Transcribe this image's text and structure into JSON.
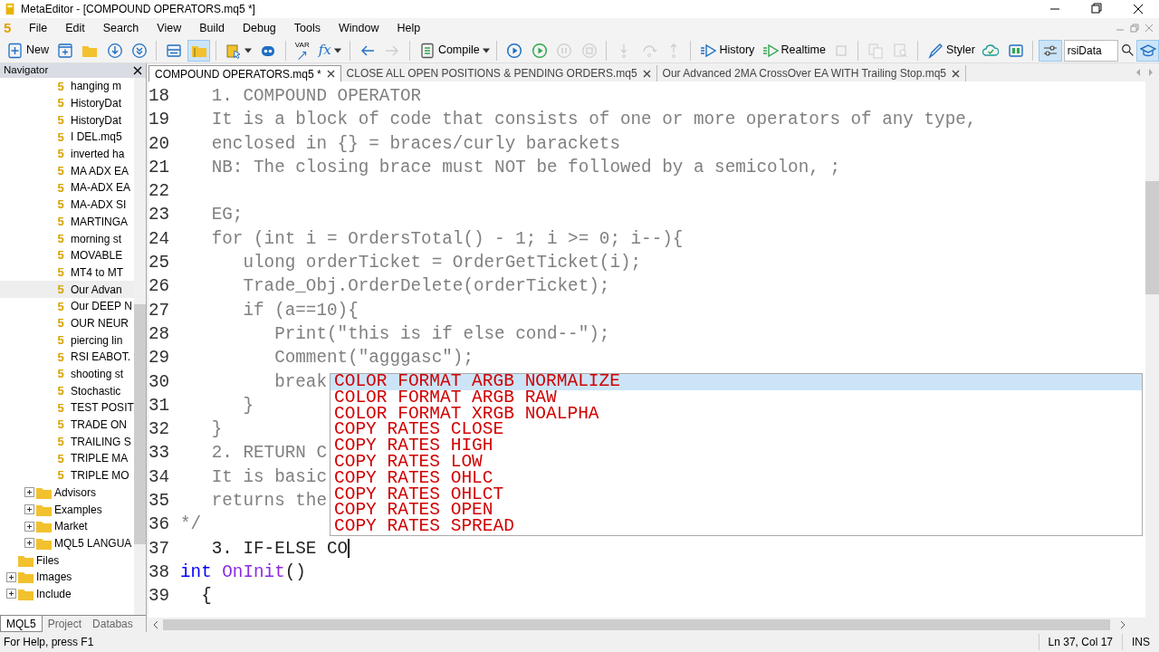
{
  "window": {
    "title": "MetaEditor - [COMPOUND OPERATORS.mq5 *]"
  },
  "menu_bar": {
    "logo": "5",
    "items": [
      "File",
      "Edit",
      "Search",
      "View",
      "Build",
      "Debug",
      "Tools",
      "Window",
      "Help"
    ]
  },
  "toolbar": [
    {
      "kind": "button",
      "label": "New",
      "pressed": false,
      "disabled": false,
      "dropdown": false
    },
    {
      "kind": "button",
      "pressed": false,
      "disabled": false,
      "dropdown": false
    },
    {
      "kind": "button",
      "pressed": false,
      "disabled": false,
      "dropdown": false
    },
    {
      "kind": "button",
      "pressed": false,
      "disabled": false,
      "dropdown": false
    },
    {
      "kind": "button",
      "pressed": false,
      "disabled": false,
      "dropdown": false
    },
    {
      "kind": "separator"
    },
    {
      "kind": "button",
      "pressed": false,
      "disabled": false,
      "dropdown": false
    },
    {
      "kind": "button",
      "pressed": true,
      "disabled": false,
      "dropdown": false
    },
    {
      "kind": "separator"
    },
    {
      "kind": "button",
      "pressed": false,
      "disabled": false,
      "dropdown": true
    },
    {
      "kind": "button",
      "pressed": false,
      "disabled": false,
      "dropdown": false
    },
    {
      "kind": "separator"
    },
    {
      "kind": "button",
      "label": "VAR",
      "pressed": false,
      "disabled": false,
      "dropdown": false
    },
    {
      "kind": "button",
      "label": "fx",
      "pressed": false,
      "disabled": false,
      "dropdown": true
    },
    {
      "kind": "separator"
    },
    {
      "kind": "button",
      "pressed": false,
      "disabled": false,
      "dropdown": false
    },
    {
      "kind": "button",
      "pressed": false,
      "disabled": true,
      "dropdown": false
    },
    {
      "kind": "separator"
    },
    {
      "kind": "button",
      "label": "Compile",
      "pressed": false,
      "disabled": false,
      "dropdown": true
    },
    {
      "kind": "separator"
    },
    {
      "kind": "button",
      "pressed": false,
      "disabled": false,
      "dropdown": false
    },
    {
      "kind": "button",
      "pressed": false,
      "disabled": false,
      "dropdown": false
    },
    {
      "kind": "button",
      "pressed": false,
      "disabled": true,
      "dropdown": false
    },
    {
      "kind": "button",
      "pressed": false,
      "disabled": true,
      "dropdown": false
    },
    {
      "kind": "separator"
    },
    {
      "kind": "button",
      "pressed": false,
      "disabled": true,
      "dropdown": false
    },
    {
      "kind": "button",
      "pressed": false,
      "disabled": true,
      "dropdown": false
    },
    {
      "kind": "button",
      "pressed": false,
      "disabled": true,
      "dropdown": false
    },
    {
      "kind": "separator"
    },
    {
      "kind": "button",
      "label": "History",
      "pressed": false,
      "disabled": false,
      "dropdown": false
    },
    {
      "kind": "button",
      "label": "Realtime",
      "pressed": false,
      "disabled": false,
      "dropdown": false
    },
    {
      "kind": "button",
      "pressed": false,
      "disabled": true,
      "dropdown": false
    },
    {
      "kind": "separator"
    },
    {
      "kind": "button",
      "pressed": false,
      "disabled": true,
      "dropdown": false
    },
    {
      "kind": "button",
      "pressed": false,
      "disabled": true,
      "dropdown": false
    },
    {
      "kind": "separator"
    },
    {
      "kind": "button",
      "label": "Styler",
      "pressed": false,
      "disabled": false,
      "dropdown": false
    },
    {
      "kind": "button",
      "pressed": false,
      "disabled": false,
      "dropdown": false
    },
    {
      "kind": "button",
      "pressed": false,
      "disabled": false,
      "dropdown": false
    },
    {
      "kind": "separator"
    },
    {
      "kind": "button",
      "pressed": true,
      "disabled": false,
      "dropdown": false
    },
    {
      "kind": "search",
      "value": "rsiData"
    },
    {
      "kind": "button",
      "pressed": true,
      "disabled": false,
      "dropdown": false
    }
  ],
  "navigator": {
    "title": "Navigator",
    "tree": [
      {
        "children": [
          {
            "children": [
              {
                "kind": "file",
                "icon": "5",
                "label": "hanging m",
                "selected": false
              },
              {
                "kind": "file",
                "icon": "5",
                "label": "HistoryDat",
                "selected": false
              },
              {
                "kind": "file",
                "icon": "5",
                "label": "HistoryDat",
                "selected": false
              },
              {
                "kind": "file",
                "icon": "5",
                "label": "I DEL.mq5",
                "selected": false
              },
              {
                "kind": "file",
                "icon": "5",
                "label": "inverted ha",
                "selected": false
              },
              {
                "kind": "file",
                "icon": "5",
                "label": "MA ADX EA",
                "selected": false
              },
              {
                "kind": "file",
                "icon": "5",
                "label": "MA-ADX EA",
                "selected": false
              },
              {
                "kind": "file",
                "icon": "5",
                "label": "MA-ADX SI",
                "selected": false
              },
              {
                "kind": "file",
                "icon": "5",
                "label": "MARTINGA",
                "selected": false
              },
              {
                "kind": "file",
                "icon": "5",
                "label": "morning st",
                "selected": false
              },
              {
                "kind": "file",
                "icon": "5",
                "label": "MOVABLE",
                "selected": false
              },
              {
                "kind": "file",
                "icon": "5",
                "label": "MT4 to MT",
                "selected": false
              },
              {
                "kind": "file",
                "icon": "5",
                "label": "Our Advan",
                "selected": true
              },
              {
                "kind": "file",
                "icon": "5",
                "label": "Our DEEP N",
                "selected": false
              },
              {
                "kind": "file",
                "icon": "5",
                "label": "OUR NEUR",
                "selected": false
              },
              {
                "kind": "file",
                "icon": "5",
                "label": "piercing lin",
                "selected": false
              },
              {
                "kind": "file",
                "icon": "5",
                "label": "RSI EABOT.",
                "selected": false
              },
              {
                "kind": "file",
                "icon": "5",
                "label": "shooting st",
                "selected": false
              },
              {
                "kind": "file",
                "icon": "5",
                "label": "Stochastic",
                "selected": false
              },
              {
                "kind": "file",
                "icon": "5",
                "label": "TEST POSIT",
                "selected": false
              },
              {
                "kind": "file",
                "icon": "5",
                "label": "TRADE ON",
                "selected": false
              },
              {
                "kind": "file",
                "icon": "5",
                "label": "TRAILING S",
                "selected": false
              },
              {
                "kind": "file",
                "icon": "5",
                "label": "TRIPLE MA",
                "selected": false
              },
              {
                "kind": "file",
                "icon": "5",
                "label": "TRIPLE MO",
                "selected": false
              }
            ]
          },
          {
            "kind": "folder",
            "label": "Advisors",
            "expanded": false
          },
          {
            "kind": "folder",
            "label": "Examples",
            "expanded": false
          },
          {
            "kind": "folder",
            "label": "Market",
            "expanded": false
          },
          {
            "kind": "folder",
            "label": "MQL5 LANGUA",
            "expanded": false
          }
        ]
      },
      {
        "kind": "folder",
        "label": "Files"
      },
      {
        "kind": "folder",
        "label": "Images",
        "expanded": false
      },
      {
        "kind": "folder",
        "label": "Include",
        "expanded": false
      }
    ],
    "tabs": [
      {
        "label": "MQL5",
        "selected": true
      },
      {
        "label": "Project",
        "selected": false
      },
      {
        "label": "Databas",
        "selected": false
      }
    ]
  },
  "editor": {
    "tabs": [
      {
        "label": "COMPOUND OPERATORS.mq5 *",
        "selected": true
      },
      {
        "label": "CLOSE ALL OPEN POSITIONS & PENDING ORDERS.mq5",
        "selected": false
      },
      {
        "label": "Our Advanced 2MA CrossOver EA WITH Trailing Stop.mq5",
        "selected": false
      }
    ],
    "lines": [
      {
        "number": "18",
        "caret": false,
        "tokens": [
          {
            "text": "   1. COMPOUND OPERATOR",
            "kind": "comment"
          }
        ]
      },
      {
        "number": "19",
        "caret": false,
        "tokens": [
          {
            "text": "   It is a block of code that consists of one or more operators of any type,",
            "kind": "comment"
          }
        ]
      },
      {
        "number": "20",
        "caret": false,
        "tokens": [
          {
            "text": "   enclosed in {} = braces/curly barackets",
            "kind": "comment"
          }
        ]
      },
      {
        "number": "21",
        "caret": false,
        "tokens": [
          {
            "text": "   NB: The closing brace must NOT be followed by a semicolon, ;",
            "kind": "comment"
          }
        ]
      },
      {
        "number": "22"
      },
      {
        "number": "23",
        "caret": false,
        "tokens": [
          {
            "text": "   EG;",
            "kind": "comment"
          }
        ]
      },
      {
        "number": "24",
        "caret": false,
        "tokens": [
          {
            "text": "   for (int i = OrdersTotal() - 1; i >= 0; i--){",
            "kind": "comment"
          }
        ]
      },
      {
        "number": "25",
        "caret": false,
        "tokens": [
          {
            "text": "      ulong orderTicket = OrderGetTicket(i);",
            "kind": "comment"
          }
        ]
      },
      {
        "number": "26",
        "caret": false,
        "tokens": [
          {
            "text": "      Trade_Obj.OrderDelete(orderTicket);",
            "kind": "comment"
          }
        ]
      },
      {
        "number": "27",
        "caret": false,
        "tokens": [
          {
            "text": "      if (a==10){",
            "kind": "comment"
          }
        ]
      },
      {
        "number": "28",
        "caret": false,
        "tokens": [
          {
            "text": "         Print(\"this is if else cond--\");",
            "kind": "comment"
          }
        ]
      },
      {
        "number": "29",
        "caret": false,
        "tokens": [
          {
            "text": "         Comment(\"agggasc\");",
            "kind": "comment"
          }
        ]
      },
      {
        "number": "30",
        "caret": false,
        "tokens": [
          {
            "text": "         break",
            "kind": "comment"
          }
        ]
      },
      {
        "number": "31",
        "caret": false,
        "tokens": [
          {
            "text": "      }",
            "kind": "comment"
          }
        ]
      },
      {
        "number": "32",
        "caret": false,
        "tokens": [
          {
            "text": "   }",
            "kind": "comment"
          }
        ]
      },
      {
        "number": "33",
        "caret": false,
        "tokens": [
          {
            "text": "   2. RETURN C",
            "kind": "comment"
          }
        ]
      },
      {
        "number": "34",
        "caret": false,
        "tokens": [
          {
            "text": "   It is basic",
            "kind": "comment"
          }
        ]
      },
      {
        "number": "35",
        "caret": false,
        "tokens": [
          {
            "text": "   returns the",
            "kind": "comment"
          }
        ]
      },
      {
        "number": "36",
        "caret": false,
        "tokens": [
          {
            "text": "*/",
            "kind": "comment"
          }
        ]
      },
      {
        "number": "37",
        "caret": true,
        "tokens": [
          {
            "text": "   3. IF-ELSE CO",
            "kind": "plain"
          }
        ]
      },
      {
        "number": "38",
        "caret": false,
        "tokens": [
          {
            "text": "int",
            "kind": "keyword"
          },
          {
            "text": " OnInit",
            "kind": "function"
          },
          {
            "text": "()",
            "kind": "plain"
          }
        ]
      },
      {
        "number": "39",
        "caret": false,
        "tokens": [
          {
            "text": "  {",
            "kind": "plain"
          }
        ]
      }
    ],
    "autocomplete": [
      {
        "text": "COLOR FORMAT ARGB NORMALIZE",
        "selected": true
      },
      {
        "text": "COLOR FORMAT ARGB RAW",
        "selected": false
      },
      {
        "text": "COLOR FORMAT XRGB NOALPHA",
        "selected": false
      },
      {
        "text": "COPY RATES CLOSE",
        "selected": false
      },
      {
        "text": "COPY RATES HIGH",
        "selected": false
      },
      {
        "text": "COPY RATES LOW",
        "selected": false
      },
      {
        "text": "COPY RATES OHLC",
        "selected": false
      },
      {
        "text": "COPY RATES OHLCT",
        "selected": false
      },
      {
        "text": "COPY RATES OPEN",
        "selected": false
      },
      {
        "text": "COPY RATES SPREAD",
        "selected": false
      }
    ]
  },
  "status_bar": {
    "help": "For Help, press F1",
    "position": "Ln 37, Col 17",
    "mode": "INS"
  }
}
